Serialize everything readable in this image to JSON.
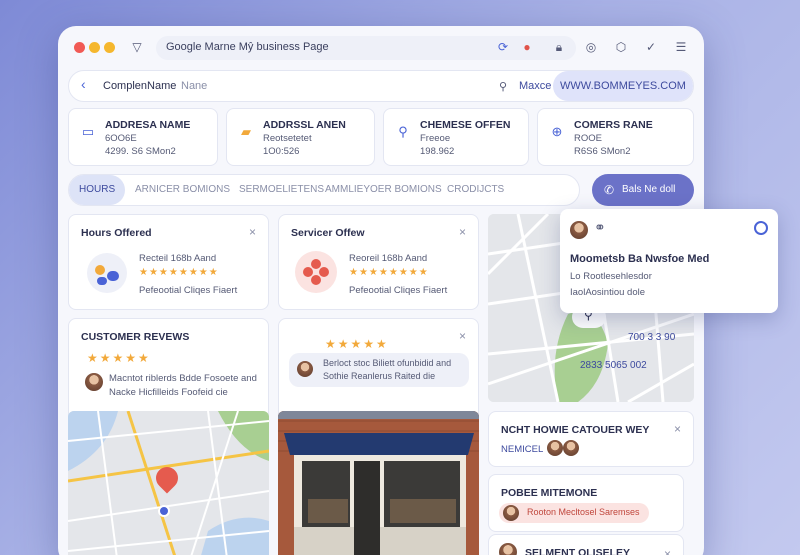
{
  "browser": {
    "address": "Google Marne Mŷ business Page",
    "colors": {
      "close": "#f15a55",
      "min": "#f5b72e",
      "max": "#f5b72e"
    }
  },
  "searchbar": {
    "back_icon": "chevron-left-icon",
    "name_label": "ComplenName",
    "name_value": "Nane",
    "action_label": "Maxce",
    "url": "WWW.BOMMEYES.COM"
  },
  "info_cards": [
    {
      "icon": "card-icon",
      "title": "ADDRESA NAME",
      "line1": "6OO6E",
      "line2": "4299. S6 SMon2"
    },
    {
      "icon": "briefcase-icon",
      "title": "ADDRSSL ANEN",
      "line1": "Reotsetetet",
      "line2": "1O0:526"
    },
    {
      "icon": "pin-icon",
      "title": "CHEMESE OFFEN",
      "line1": "Freeoe",
      "line2": "198.962"
    },
    {
      "icon": "crosshair-icon",
      "title": "COMERS RANE",
      "line1": "ROOE",
      "line2": "R6S6 SMon2"
    }
  ],
  "tabs": [
    "HOURS",
    "ARNICER BOMIONS",
    "SERMOELIETENS",
    "AMMLIEYOER BOMIONS",
    "CRODIJCTS"
  ],
  "call_button": "Bals Ne doll",
  "hours_card": {
    "title": "Hours Offered",
    "line1": "Recteil 168b Aand",
    "line2": "Pefeootial Cliqes Fiaert"
  },
  "services_card": {
    "title": "Servicer Offew",
    "line1": "Reoreil 168b Aand",
    "line2": "Pefeootial Cliqes Fiaert"
  },
  "reviews_card": {
    "title": "CUSTOMER REVEWS",
    "stars": "★★★★★",
    "line1": "Macntot riblerds Bdde Fosoete and",
    "line2": "Nacke Hicfilleids Foofeid cie"
  },
  "review_card_2": {
    "stars": "★★★★★",
    "line1": "Berloct stoc Biliett ofunbidid and",
    "line2": "Sothie Reanlerus Raited die"
  },
  "map": {
    "label1": "700 3 3 90",
    "label2": "2833 5065 002"
  },
  "popup": {
    "title": "Moometsb Ba Nwsfoe Med",
    "line1": "Lo Rootlesehlesdor",
    "line2": "IaolAosintiou dole"
  },
  "nch_card": {
    "title": "NCHT HOWIE CATOUER WEY",
    "subtitle": "NEMICEL"
  },
  "posee_card": {
    "title": "POBEE MITEMONE",
    "line1": "Rooton Mecltosel Saremses"
  },
  "bottom_card": {
    "title": "SELMENT OLISELEY"
  }
}
